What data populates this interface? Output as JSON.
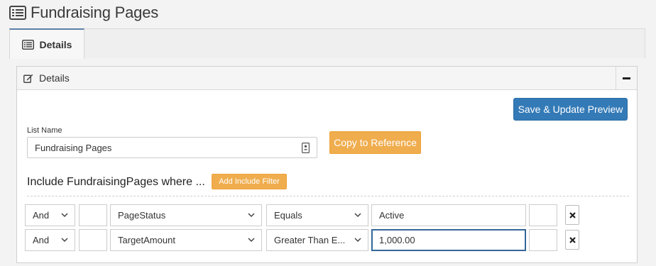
{
  "page": {
    "title": "Fundraising Pages",
    "icon": "list-icon"
  },
  "tabs": [
    {
      "label": "Details",
      "icon": "list-icon",
      "active": true
    }
  ],
  "panel": {
    "title": "Details",
    "icon": "edit-icon",
    "collapse_icon": "minus-icon"
  },
  "toolbar": {
    "save_label": "Save & Update Preview"
  },
  "list_name": {
    "label": "List Name",
    "value": "Fundraising Pages",
    "icon": "contact-card-icon",
    "copy_label": "Copy to Reference"
  },
  "include": {
    "label": "Include FundraisingPages where ...",
    "add_filter_label": "Add Include Filter"
  },
  "filters": [
    {
      "conjunction": "And",
      "field": "PageStatus",
      "operator": "Equals",
      "value": "Active"
    },
    {
      "conjunction": "And",
      "field": "TargetAmount",
      "operator": "Greater Than E...",
      "value": "1,000.00"
    }
  ],
  "remove_icon": "close-icon",
  "colors": {
    "primary": "#337ab7",
    "warning": "#f0ad4e",
    "tab_accent": "#5b7fa6"
  }
}
